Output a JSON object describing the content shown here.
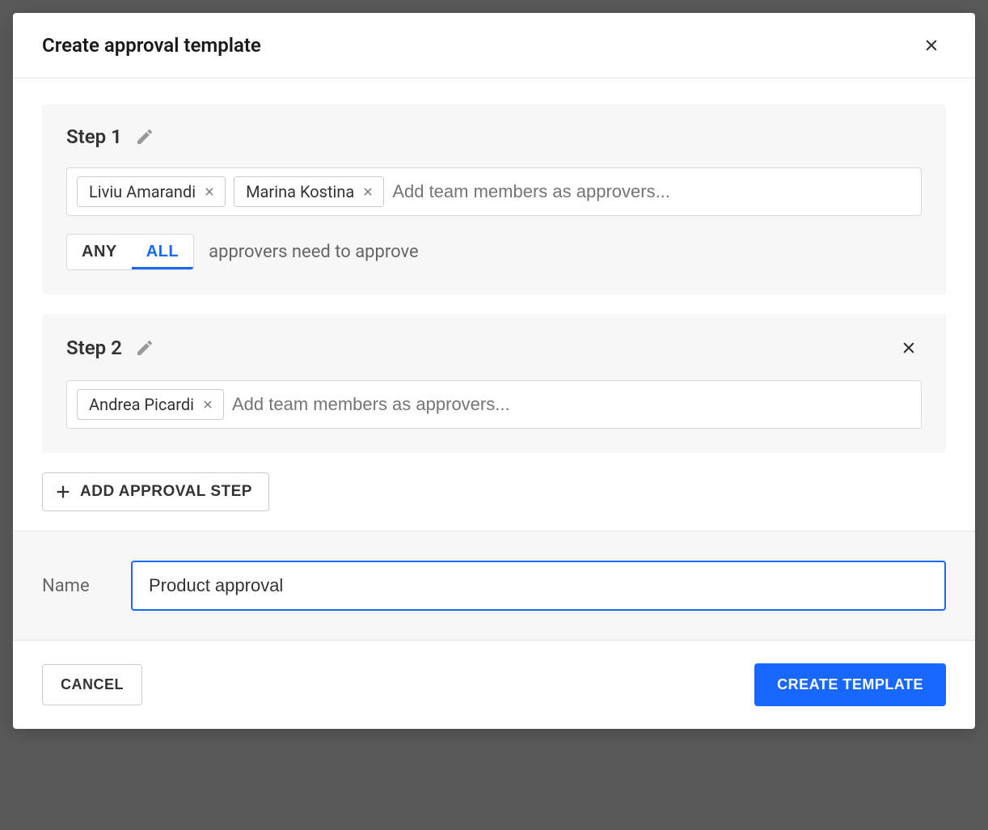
{
  "modal": {
    "title": "Create approval template",
    "steps": [
      {
        "title": "Step 1",
        "removable": false,
        "approvers": [
          "Liviu Amarandi",
          "Marina Kostina"
        ],
        "placeholder": "Add team members as approvers...",
        "show_toggle": true,
        "toggle": {
          "any_label": "ANY",
          "all_label": "ALL",
          "selected": "ALL",
          "description": "approvers need to approve"
        }
      },
      {
        "title": "Step 2",
        "removable": true,
        "approvers": [
          "Andrea Picardi"
        ],
        "placeholder": "Add team members as approvers...",
        "show_toggle": false
      }
    ],
    "add_step_label": "ADD APPROVAL STEP",
    "name_section": {
      "label": "Name",
      "value": "Product approval"
    },
    "footer": {
      "cancel_label": "CANCEL",
      "create_label": "CREATE TEMPLATE"
    }
  }
}
